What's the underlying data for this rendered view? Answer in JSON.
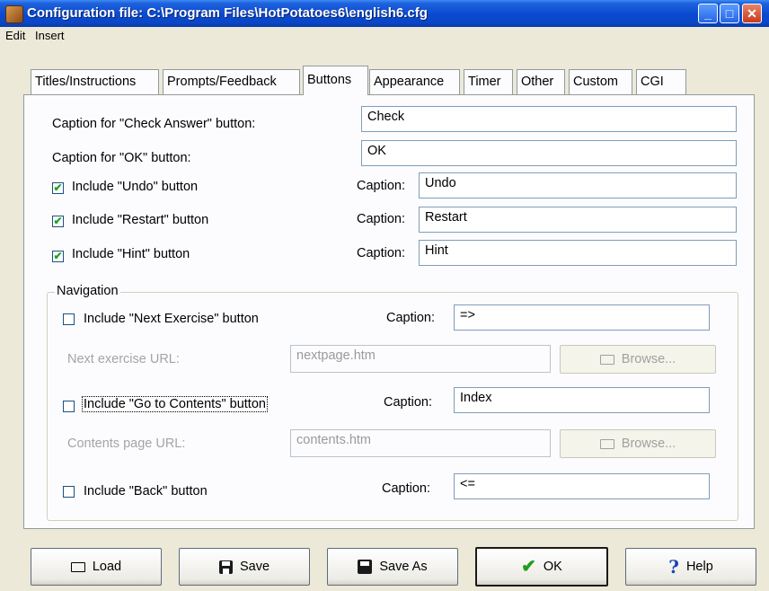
{
  "window": {
    "title": "Configuration file: C:\\Program Files\\HotPotatoes6\\english6.cfg",
    "controls": {
      "minimize": "_",
      "maximize": "□",
      "close": "✕"
    }
  },
  "menu": {
    "items": [
      "Edit",
      "Insert"
    ]
  },
  "tabs": [
    {
      "label": "Titles/Instructions"
    },
    {
      "label": "Prompts/Feedback"
    },
    {
      "label": "Buttons"
    },
    {
      "label": "Appearance"
    },
    {
      "label": "Timer"
    },
    {
      "label": "Other"
    },
    {
      "label": "Custom"
    },
    {
      "label": "CGI"
    }
  ],
  "buttons_tab": {
    "check_answer": {
      "label": "Caption for \"Check Answer\" button:",
      "value": "Check"
    },
    "ok": {
      "label": "Caption for \"OK\" button:",
      "value": "OK"
    },
    "undo": {
      "label": "Include \"Undo\" button",
      "checked": true,
      "caption_label": "Caption:",
      "value": "Undo"
    },
    "restart": {
      "label": "Include \"Restart\" button",
      "checked": true,
      "caption_label": "Caption:",
      "value": "Restart"
    },
    "hint": {
      "label": "Include \"Hint\" button",
      "checked": true,
      "caption_label": "Caption:",
      "value": "Hint"
    },
    "navigation": {
      "group_label": "Navigation",
      "next_exercise": {
        "label": "Include \"Next Exercise\" button",
        "checked": false,
        "caption_label": "Caption:",
        "value": "=>"
      },
      "next_url": {
        "label": "Next exercise URL:",
        "value": "nextpage.htm",
        "browse_label": "Browse..."
      },
      "go_to_contents": {
        "label": "Include \"Go to Contents\" button",
        "checked": false,
        "caption_label": "Caption:",
        "value": "Index"
      },
      "contents_url": {
        "label": "Contents page URL:",
        "value": "contents.htm",
        "browse_label": "Browse..."
      },
      "back": {
        "label": "Include \"Back\" button",
        "checked": false,
        "caption_label": "Caption:",
        "value": "<="
      }
    }
  },
  "footer": {
    "load": "Load",
    "save": "Save",
    "save_as": "Save As",
    "ok": "OK",
    "help": "Help"
  },
  "colors": {
    "titlebar": "#0a49d0",
    "window_bg": "#ece9d8",
    "panel_bg": "#fcfcfe",
    "check_green": "#21a121"
  }
}
